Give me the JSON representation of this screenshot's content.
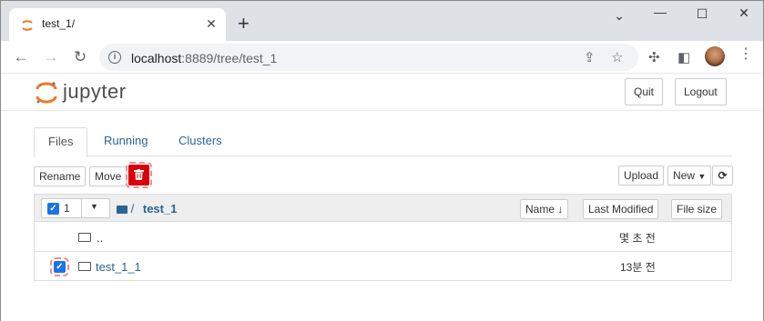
{
  "browser": {
    "tab_title": "test_1/",
    "new_tab": "+",
    "url_host": "localhost",
    "url_path": ":8889/tree/test_1"
  },
  "header": {
    "logo_text": "jupyter",
    "quit_label": "Quit",
    "logout_label": "Logout"
  },
  "tabs": [
    {
      "label": "Files"
    },
    {
      "label": "Running"
    },
    {
      "label": "Clusters"
    }
  ],
  "actions": {
    "rename_label": "Rename",
    "move_label": "Move",
    "upload_label": "Upload",
    "new_label": "New"
  },
  "list": {
    "selected_count": "1",
    "breadcrumb_sep": "/",
    "breadcrumb_folder": "test_1",
    "sort_name_label": "Name",
    "last_modified_label": "Last Modified",
    "file_size_label": "File size",
    "rows": [
      {
        "name": "..",
        "modified": "몇 초 전",
        "checked": false
      },
      {
        "name": "test_1_1",
        "modified": "13분 전",
        "checked": true
      }
    ]
  },
  "colors": {
    "accent_link": "#2a6496",
    "delete_red": "#d9000b",
    "checkbox_blue": "#1a73e8"
  }
}
